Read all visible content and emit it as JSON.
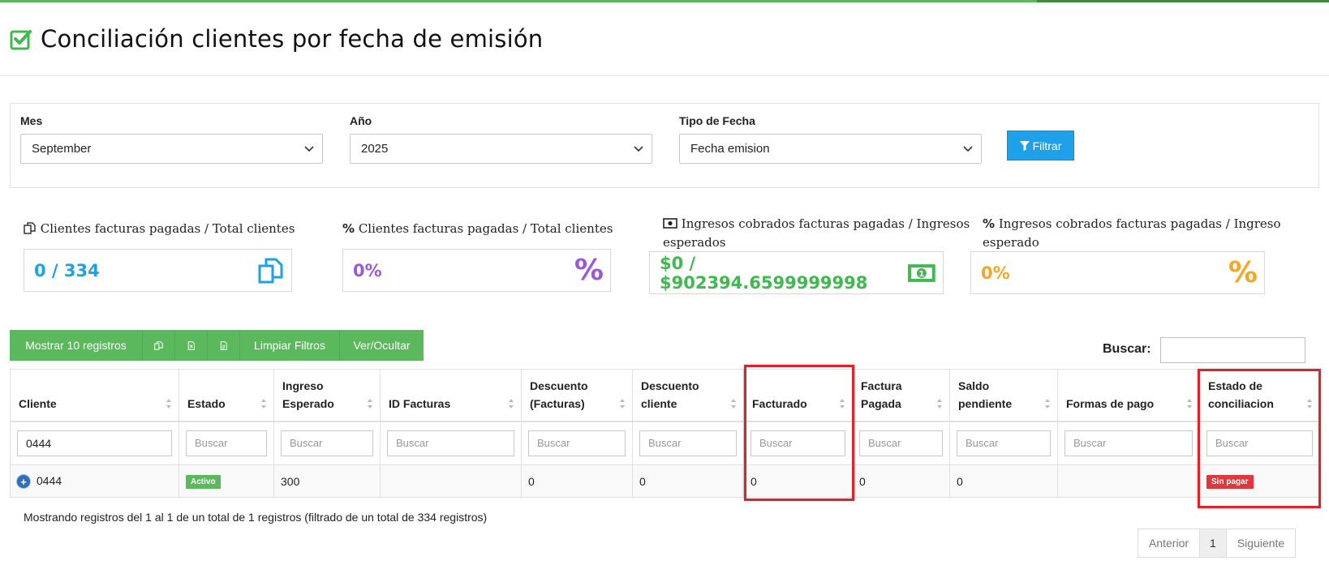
{
  "page": {
    "title": "Conciliación clientes por fecha de emisión",
    "icon": "checkbox-check-icon",
    "accent": "#5cb85c"
  },
  "filters": {
    "mes": {
      "label": "Mes",
      "value": "September"
    },
    "anio": {
      "label": "Año",
      "value": "2025"
    },
    "tipo_fecha": {
      "label": "Tipo de Fecha",
      "value": "Fecha emision"
    },
    "filter_button": "Filtrar"
  },
  "stats": [
    {
      "title": "Clientes facturas pagadas / Total clientes",
      "value": "0 / 334",
      "color": "#1ea1e8",
      "icon": "copy-icon"
    },
    {
      "title": "Clientes facturas pagadas / Total clientes",
      "value": "0%",
      "color": "#9b59d6",
      "icon": "percent-icon"
    },
    {
      "title_line1": "Ingresos cobrados facturas pagadas / Ingresos",
      "title_line2": "esperados",
      "value": "$0 / $902394.6599999998",
      "color": "#3fb950",
      "icon": "money-bill-icon"
    },
    {
      "title_line1": "Ingresos cobrados facturas pagadas / Ingreso",
      "title_line2": "esperado",
      "value": "0%",
      "color": "#f5a623",
      "icon": "percent-icon"
    }
  ],
  "toolbar": {
    "show_records": "Mostrar 10 registros",
    "clear_filters": "Limpiar Filtros",
    "toggle_columns": "Ver/Ocultar"
  },
  "search": {
    "label": "Buscar:",
    "value": ""
  },
  "table": {
    "headers": [
      {
        "line1": "Cliente",
        "line2": ""
      },
      {
        "line1": "Estado",
        "line2": ""
      },
      {
        "line1": "Ingreso",
        "line2": "Esperado"
      },
      {
        "line1": "ID Facturas",
        "line2": ""
      },
      {
        "line1": "Descuento",
        "line2": "(Facturas)"
      },
      {
        "line1": "Descuento",
        "line2": "cliente"
      },
      {
        "line1": "Facturado",
        "line2": ""
      },
      {
        "line1": "Factura",
        "line2": "Pagada"
      },
      {
        "line1": "Saldo",
        "line2": "pendiente"
      },
      {
        "line1": "Formas de pago",
        "line2": ""
      },
      {
        "line1": "Estado de",
        "line2": "conciliacion"
      }
    ],
    "filter_placeholder": "Buscar",
    "client_filter_value": "0444",
    "rows": [
      {
        "cliente": "0444",
        "estado": "Activo",
        "estado_color": "#5cb85c",
        "ingreso_esperado": "300",
        "id_facturas": "",
        "descuento_facturas": "0",
        "descuento_cliente": "0",
        "facturado": "0",
        "factura_pagada": "0",
        "saldo_pendiente": "0",
        "formas_pago": "",
        "estado_conciliacion": "Sin pagar",
        "estado_conciliacion_color": "#e0363d"
      }
    ]
  },
  "footer": {
    "info": "Mostrando registros del 1 al 1 de un total de 1 registros (filtrado de un total de 334 registros)",
    "prev": "Anterior",
    "page": "1",
    "next": "Siguiente"
  }
}
